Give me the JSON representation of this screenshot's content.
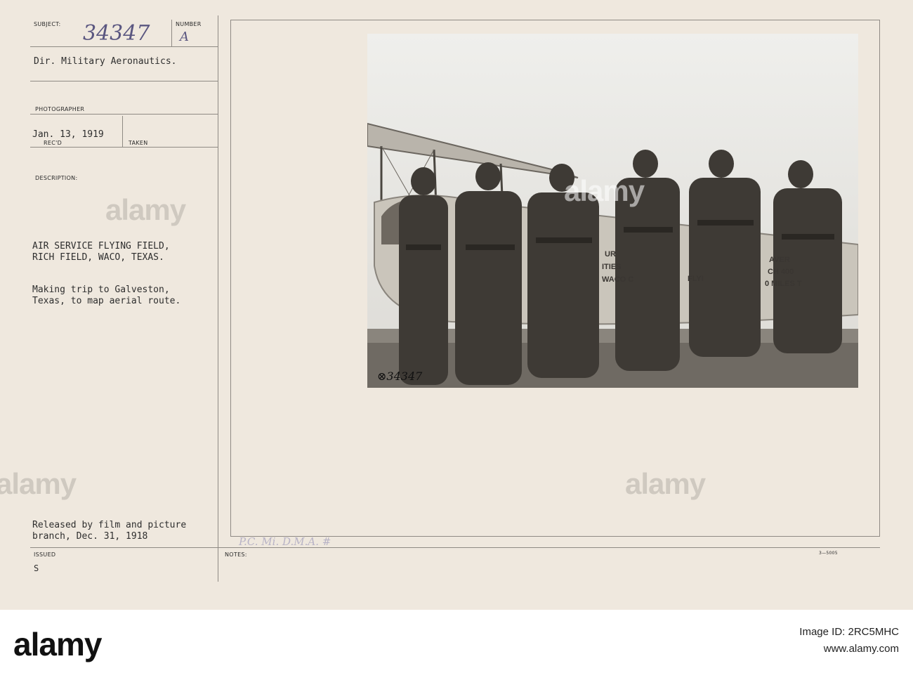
{
  "card": {
    "subject_label": "SUBJECT:",
    "number_label": "NUMBER",
    "subject_number": "34347",
    "number_value": "A",
    "subject_title": "Dir. Military Aeronautics.",
    "photographer_label": "PHOTOGRAPHER",
    "received_date": "Jan. 13, 1919",
    "recd_label": "REC'D",
    "taken_label": "TAKEN",
    "description_label": "DESCRIPTION:",
    "description_line1": "AIR SERVICE FLYING FIELD,",
    "description_line2": "RICH FIELD, WACO, TEXAS.",
    "caption_line1": "Making trip to Galveston,",
    "caption_line2": "Texas, to map aerial route.",
    "released_line1": "Released by film and picture",
    "released_line2": "branch, Dec. 31, 1918",
    "issued_label": "ISSUED",
    "issued_value": "S",
    "notes_label": "NOTES:",
    "notes_handwritten": "P.C. Mi. D.M.A. #",
    "form_number": "3—5005"
  },
  "photo": {
    "number_mark": "⊗34347",
    "plane_text": [
      "UR",
      "ITIES",
      "WACO C",
      "AVER",
      "CH 400",
      "FLYI",
      "0 MILES T"
    ]
  },
  "watermark": {
    "text": "alamy"
  },
  "footer": {
    "logo": "alamy",
    "image_id": "Image ID: 2RC5MHC",
    "url": "www.alamy.com"
  },
  "colors": {
    "card": "#efe8de",
    "photo": "#7d7a73",
    "rule": "#8f8a84",
    "footer": "#ffffff"
  }
}
